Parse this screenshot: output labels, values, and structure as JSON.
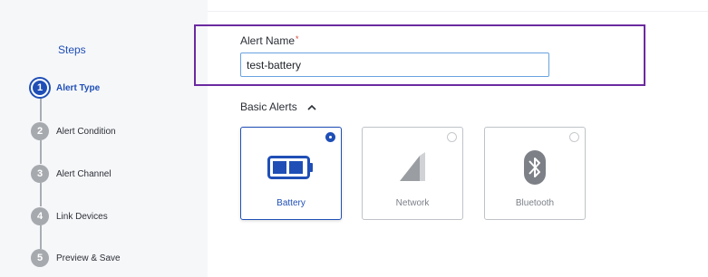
{
  "sidebar": {
    "title": "Steps",
    "steps": [
      {
        "number": "1",
        "label": "Alert Type",
        "active": true
      },
      {
        "number": "2",
        "label": "Alert Condition",
        "active": false
      },
      {
        "number": "3",
        "label": "Alert Channel",
        "active": false
      },
      {
        "number": "4",
        "label": "Link Devices",
        "active": false
      },
      {
        "number": "5",
        "label": "Preview & Save",
        "active": false
      }
    ]
  },
  "form": {
    "alert_name_label": "Alert Name",
    "required_mark": "*",
    "alert_name_value": "test-battery"
  },
  "basic_alerts": {
    "title": "Basic Alerts",
    "expanded": true,
    "cards": [
      {
        "label": "Battery",
        "icon": "battery-icon",
        "selected": true
      },
      {
        "label": "Network",
        "icon": "network-signal-icon",
        "selected": false
      },
      {
        "label": "Bluetooth",
        "icon": "bluetooth-icon",
        "selected": false
      }
    ]
  },
  "colors": {
    "accent": "#1f4fb6",
    "highlight_border": "#6b2aa0",
    "required": "#d6453d",
    "muted": "#a6a9ae"
  }
}
